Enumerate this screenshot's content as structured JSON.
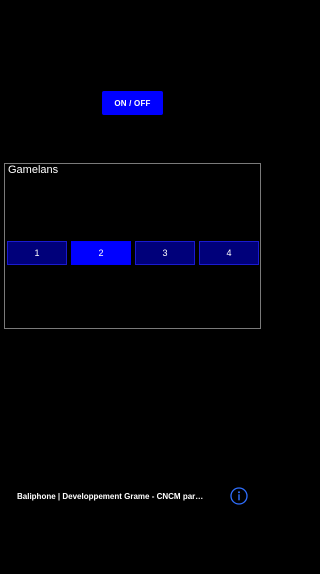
{
  "header": {
    "power_label": "ON / OFF"
  },
  "gamelans": {
    "title": "Gamelans",
    "selected": "2",
    "buttons": [
      {
        "label": "1"
      },
      {
        "label": "2"
      },
      {
        "label": "3"
      },
      {
        "label": "4"
      }
    ]
  },
  "footer": {
    "credits": "Baliphone | Developpement Grame - CNCM par…",
    "info_icon": "info-circle-icon"
  },
  "colors": {
    "background": "#000000",
    "accent": "#0000ff",
    "button_idle": "#00007a",
    "panel_border": "#7a7a7a",
    "info_icon": "#2f6fff"
  }
}
